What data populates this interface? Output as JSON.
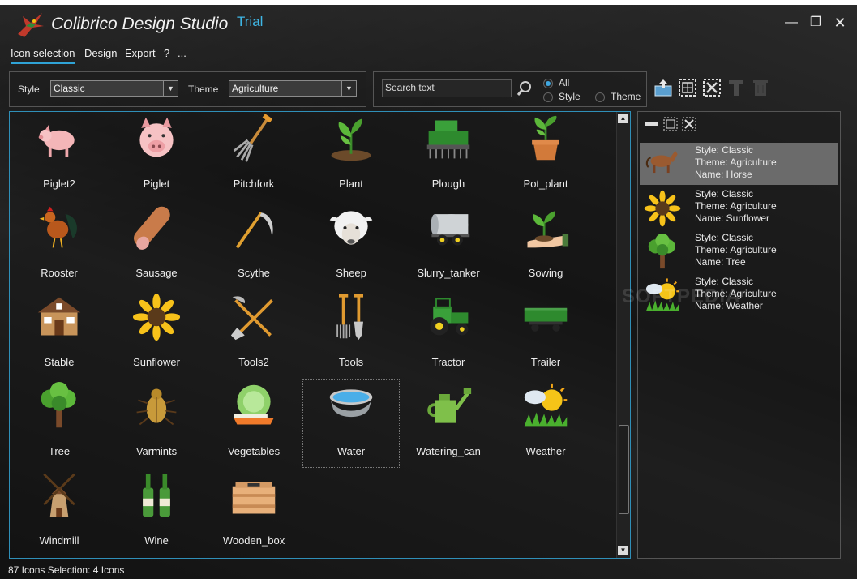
{
  "app": {
    "title": "Colibrico Design Studio",
    "badge": "Trial"
  },
  "window_controls": {
    "minimize": "—",
    "restore": "❐",
    "close": "✕"
  },
  "menu": [
    "Icon selection",
    "Design",
    "Export",
    "?",
    "..."
  ],
  "filters": {
    "style_label": "Style",
    "style_value": "Classic",
    "theme_label": "Theme",
    "theme_value": "Agriculture",
    "search_placeholder": "Search text",
    "scope_options": [
      "All",
      "Style",
      "Theme"
    ],
    "scope_selected": "All"
  },
  "toolbar_icons": [
    "export-icon",
    "select-all-icon",
    "deselect-icon",
    "text-icon",
    "delete-icon"
  ],
  "icons": [
    {
      "name": "Piglet2",
      "icon": "pig-icon"
    },
    {
      "name": "Piglet",
      "icon": "pig-head-icon"
    },
    {
      "name": "Pitchfork",
      "icon": "pitchfork-icon"
    },
    {
      "name": "Plant",
      "icon": "plant-icon"
    },
    {
      "name": "Plough",
      "icon": "plough-icon"
    },
    {
      "name": "Pot_plant",
      "icon": "pot-plant-icon"
    },
    {
      "name": "Rooster",
      "icon": "rooster-icon"
    },
    {
      "name": "Sausage",
      "icon": "sausage-icon"
    },
    {
      "name": "Scythe",
      "icon": "scythe-icon"
    },
    {
      "name": "Sheep",
      "icon": "sheep-icon"
    },
    {
      "name": "Slurry_tanker",
      "icon": "tanker-icon"
    },
    {
      "name": "Sowing",
      "icon": "sowing-icon"
    },
    {
      "name": "Stable",
      "icon": "stable-icon"
    },
    {
      "name": "Sunflower",
      "icon": "sunflower-icon"
    },
    {
      "name": "Tools2",
      "icon": "tools2-icon"
    },
    {
      "name": "Tools",
      "icon": "tools-icon"
    },
    {
      "name": "Tractor",
      "icon": "tractor-icon"
    },
    {
      "name": "Trailer",
      "icon": "trailer-icon"
    },
    {
      "name": "Tree",
      "icon": "tree-icon"
    },
    {
      "name": "Varmints",
      "icon": "beetle-icon"
    },
    {
      "name": "Vegetables",
      "icon": "vegetables-icon"
    },
    {
      "name": "Water",
      "icon": "water-bowl-icon",
      "selected": true
    },
    {
      "name": "Watering_can",
      "icon": "watering-can-icon"
    },
    {
      "name": "Weather",
      "icon": "weather-icon"
    },
    {
      "name": "Windmill",
      "icon": "windmill-icon"
    },
    {
      "name": "Wine",
      "icon": "wine-icon"
    },
    {
      "name": "Wooden_box",
      "icon": "wooden-box-icon"
    }
  ],
  "selection": [
    {
      "style": "Style: Classic",
      "theme": "Theme: Agriculture",
      "name": "Name: Horse",
      "icon": "horse-icon",
      "highlighted": true
    },
    {
      "style": "Style: Classic",
      "theme": "Theme: Agriculture",
      "name": "Name: Sunflower",
      "icon": "sunflower-icon"
    },
    {
      "style": "Style: Classic",
      "theme": "Theme: Agriculture",
      "name": "Name: Tree",
      "icon": "tree-icon"
    },
    {
      "style": "Style: Classic",
      "theme": "Theme: Agriculture",
      "name": "Name: Weather",
      "icon": "weather-icon"
    }
  ],
  "status": "87 Icons  Selection: 4 Icons",
  "watermark": "SOFTPEDIA",
  "colors": {
    "accent": "#2fa3d6",
    "trial": "#3fb7e6",
    "grid_border": "#2f8fb8"
  }
}
